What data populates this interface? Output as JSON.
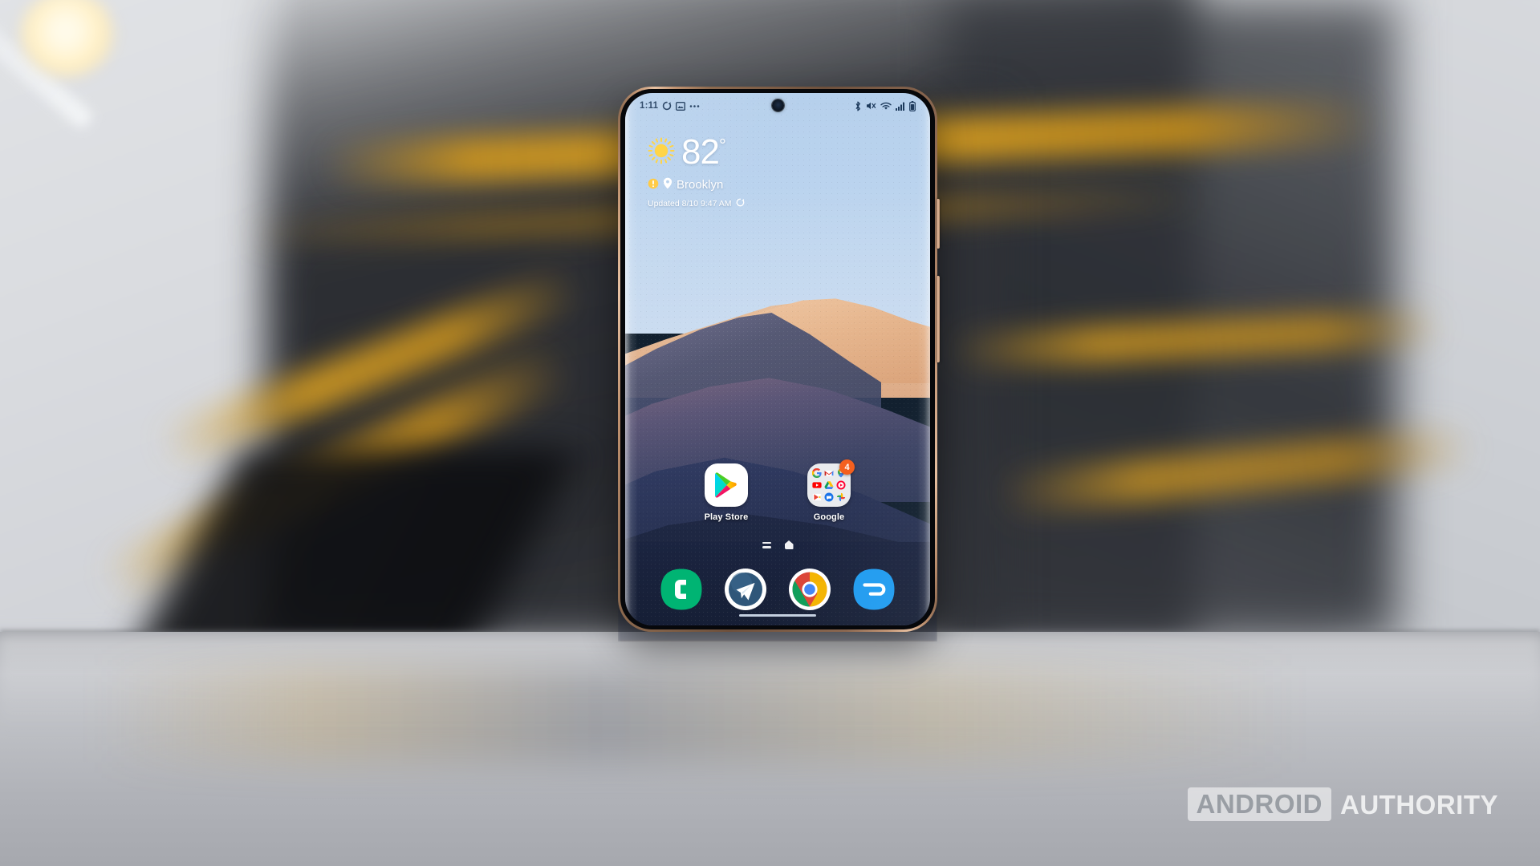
{
  "scene": {
    "subject": "Samsung Galaxy Note 20 Ultra in Mystic Bronze standing upright on a glossy surface",
    "background_description": "Blurred industrial stairwell with yellow safety rails and a bright lamp in the upper left"
  },
  "phone": {
    "frame_color": "#b78a69",
    "status_bar": {
      "time": "1:11",
      "left_icons": [
        "sync-icon",
        "screenshot-icon",
        "more-notifications-icon"
      ],
      "right_icons": [
        "bluetooth-icon",
        "volume-mute-icon",
        "wifi-icon",
        "signal-icon",
        "battery-icon"
      ]
    },
    "weather_widget": {
      "condition_icon": "sun-icon",
      "temperature": "82",
      "degree_symbol": "°",
      "alert_icon": "weather-alert-icon",
      "location_icon": "location-pin-icon",
      "location": "Brooklyn",
      "updated_text": "Updated 8/10 9:47 AM",
      "refresh_icon": "refresh-icon"
    },
    "home_screen": {
      "apps": [
        {
          "name": "play-store",
          "label": "Play Store",
          "badge": null
        },
        {
          "name": "google-folder",
          "label": "Google",
          "badge": "4"
        }
      ],
      "folder_contents": [
        "Google",
        "Gmail",
        "Maps",
        "YouTube",
        "Drive",
        "YouTube Music",
        "Play Movies",
        "Messages",
        "Photos"
      ],
      "page_indicator": {
        "app_list_icon": "app-list-icon",
        "home_icon": "home-icon"
      }
    },
    "dock": [
      {
        "name": "phone-app",
        "label": "Phone",
        "color": "#00b473"
      },
      {
        "name": "telegram-app",
        "label": "Telegram",
        "color": "#2d4f73"
      },
      {
        "name": "chrome-app",
        "label": "Chrome",
        "color": "#ffffff"
      },
      {
        "name": "samsung-app",
        "label": "Samsung",
        "color": "#1f9bf0"
      }
    ],
    "navigation": {
      "type": "gesture-bar"
    }
  },
  "watermark": {
    "boxed_text": "ANDROID",
    "plain_text": "AUTHORITY"
  },
  "colors": {
    "sky": "#bad3ee",
    "dune_light": "#e8c09d",
    "dune_dark": "#222c49",
    "badge": "#f4601f",
    "frame_bronze": "#c09270"
  }
}
